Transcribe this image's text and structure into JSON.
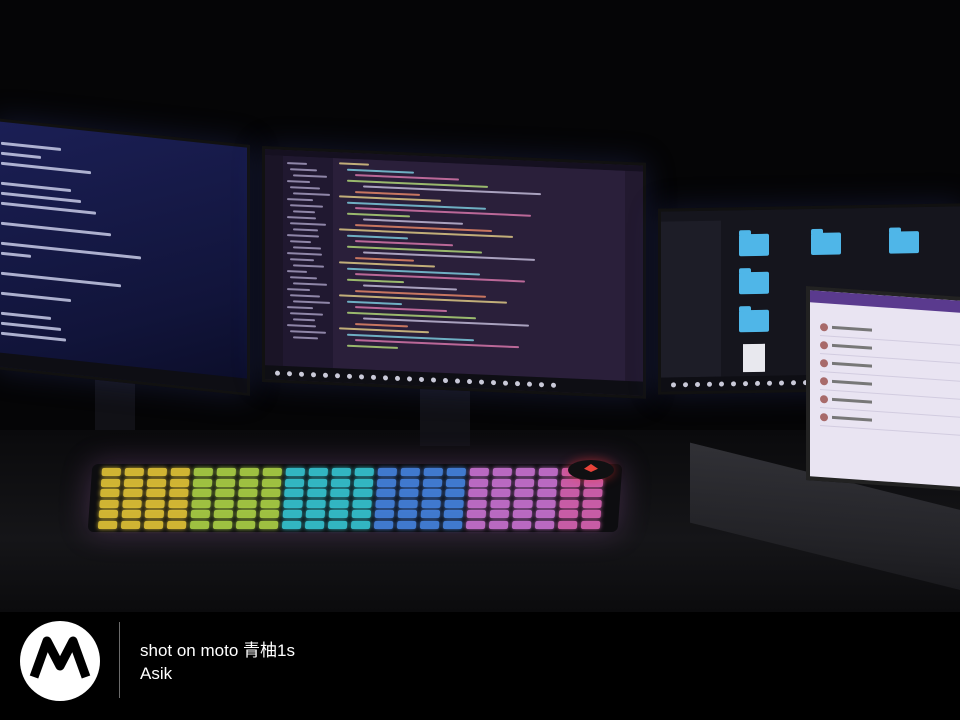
{
  "photo": {
    "subject": "night desk setup with three monitors, a laptop and an RGB keyboard"
  },
  "watermark": {
    "logo": "motorola-logo-icon",
    "title": "shot on moto 青柚1s",
    "subtitle": "Asik"
  },
  "colors": {
    "folder": "#4fb6e8",
    "code_background": "#2a1f3a",
    "terminal_background": "#1b1f55",
    "keyboard_glow_yellow": "#f2d23a",
    "keyboard_glow_cyan": "#39d3e0",
    "keyboard_glow_pink": "#d77ae0",
    "mouse_logo": "#e8433a"
  }
}
